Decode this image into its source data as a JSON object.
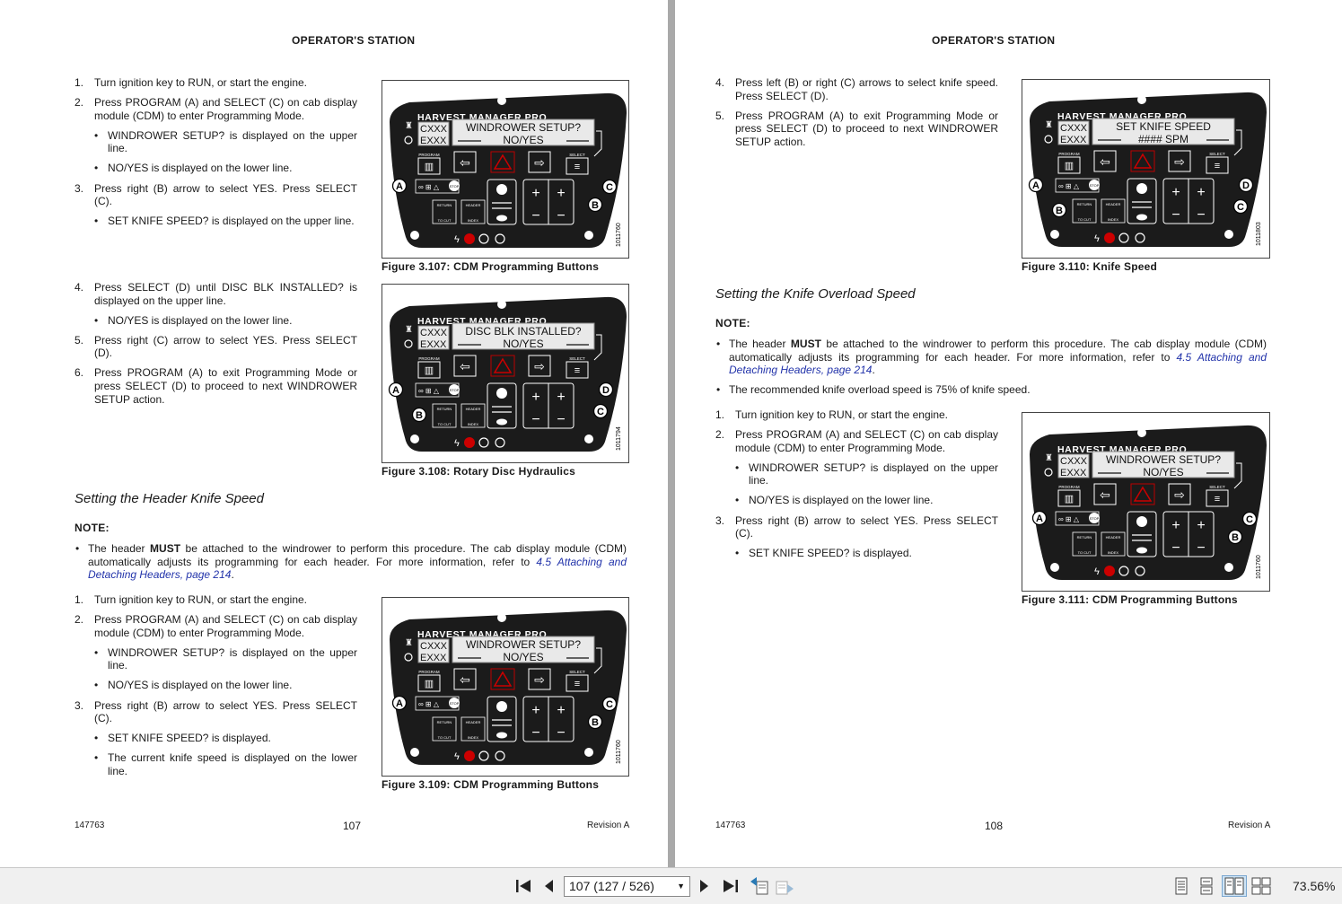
{
  "left_page": {
    "header": "OPERATOR'S STATION",
    "doc_number": "147763",
    "page_number": "107",
    "revision": "Revision  A",
    "block1": [
      {
        "num": "1.",
        "text": "Turn ignition key to RUN, or start the engine."
      },
      {
        "num": "2.",
        "text": "Press PROGRAM (A) and SELECT (C) on cab display module (CDM) to enter Programming Mode."
      },
      {
        "sub": "WINDROWER SETUP? is displayed on the upper line."
      },
      {
        "sub": "NO/YES is displayed on the lower line."
      },
      {
        "num": "3.",
        "text": "Press right (B) arrow to select YES. Press SELECT (C)."
      },
      {
        "sub": "SET KNIFE SPEED? is displayed on the upper line."
      }
    ],
    "block2": [
      {
        "num": "4.",
        "text": "Press SELECT (D) until DISC BLK INSTALLED? is displayed on the upper line."
      },
      {
        "sub": "NO/YES is displayed on the lower line."
      },
      {
        "num": "5.",
        "text": "Press right (C) arrow to select YES. Press SELECT (D)."
      },
      {
        "num": "6.",
        "text": "Press PROGRAM (A) to exit Programming Mode or press SELECT (D) to proceed to next WINDROWER SETUP action."
      }
    ],
    "section_title": "Setting the Header Knife Speed",
    "note_label": "NOTE:",
    "note_pre": "The header ",
    "note_bold": "MUST",
    "note_mid": " be attached to the windrower to perform this procedure.  The cab display module (CDM) automatically adjusts its programming for each header.  For more information, refer to ",
    "note_link": "4.5 Attaching and Detaching Headers, page 214",
    "note_post": ".",
    "block3": [
      {
        "num": "1.",
        "text": "Turn ignition key to RUN, or start the engine."
      },
      {
        "num": "2.",
        "text": "Press PROGRAM (A) and SELECT (C) on cab display module (CDM) to enter Programming Mode."
      },
      {
        "sub": "WINDROWER SETUP? is displayed on the upper line."
      },
      {
        "sub": "NO/YES is displayed on the lower line."
      },
      {
        "num": "3.",
        "text": "Press right (B) arrow to select YES. Press SELECT (C)."
      },
      {
        "sub": "SET KNIFE SPEED? is displayed."
      },
      {
        "sub": "The current knife speed is displayed on the lower line."
      }
    ],
    "fig107": {
      "caption": "Figure 3.107: CDM Programming Buttons",
      "line1": "WINDROWER SETUP?",
      "line2": "NO/YES",
      "id": "1011760"
    },
    "fig108": {
      "caption": "Figure 3.108: Rotary Disc Hydraulics",
      "line1": "DISC BLK INSTALLED?",
      "line2": "NO/YES",
      "id": "1011794"
    },
    "fig109": {
      "caption": "Figure 3.109: CDM Programming Buttons",
      "line1": "WINDROWER SETUP?",
      "line2": "NO/YES",
      "id": "1011760"
    }
  },
  "right_page": {
    "header": "OPERATOR'S STATION",
    "doc_number": "147763",
    "page_number": "108",
    "revision": "Revision  A",
    "block1": [
      {
        "num": "4.",
        "text": "Press left (B) or right (C) arrows to select knife speed. Press SELECT (D)."
      },
      {
        "num": "5.",
        "text": "Press PROGRAM (A) to exit Programming Mode or press SELECT (D) to proceed to next WINDROWER SETUP action."
      }
    ],
    "section_title": "Setting the Knife Overload Speed",
    "note_label": "NOTE:",
    "note_pre": "The header ",
    "note_bold": "MUST",
    "note_mid": " be attached to the windrower to perform this procedure.  The cab display module (CDM) automatically adjusts its programming for each header.  For more information, refer to ",
    "note_link": "4.5 Attaching and Detaching Headers, page 214",
    "note_post": ".",
    "note2": "The recommended knife overload speed is 75% of knife speed.",
    "block2": [
      {
        "num": "1.",
        "text": "Turn ignition key to RUN, or start the engine."
      },
      {
        "num": "2.",
        "text": "Press PROGRAM (A) and SELECT (C) on cab display module (CDM) to enter Programming Mode."
      },
      {
        "sub": "WINDROWER SETUP? is displayed on the upper line."
      },
      {
        "sub": "NO/YES is displayed on the lower line."
      },
      {
        "num": "3.",
        "text": "Press right (B) arrow to select YES. Press SELECT (C)."
      },
      {
        "sub": "SET KNIFE SPEED? is displayed."
      }
    ],
    "fig110": {
      "caption": "Figure 3.110: Knife Speed",
      "line1": "SET KNIFE SPEED",
      "line2": "#### SPM",
      "id": "1011803"
    },
    "fig111": {
      "caption": "Figure 3.111: CDM Programming Buttons",
      "line1": "WINDROWER SETUP?",
      "line2": "NO/YES",
      "id": "1011760"
    }
  },
  "cdm": {
    "brand": "HARVEST MANAGER PRO",
    "code1": "CXXX",
    "code2": "EXXX",
    "program": "PROGRAM",
    "select": "SELECT",
    "return_label": "RETURN",
    "to_cut": "TO CUT",
    "header_label": "HEADER",
    "index_label": "INDEX",
    "stop": "STOP"
  },
  "toolbar": {
    "page_value": "107 (127 / 526)",
    "zoom": "73.56%"
  }
}
